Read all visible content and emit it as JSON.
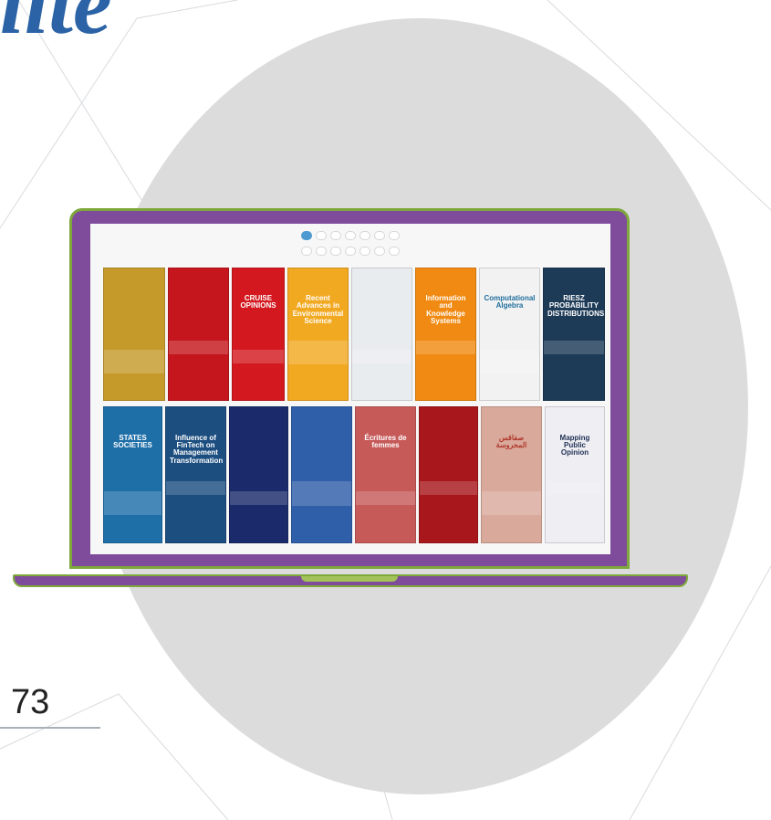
{
  "heading": "lite",
  "page_number": "73",
  "colors": {
    "heading_blue": "#2b63a6",
    "circle_grey": "#dcdcdc",
    "laptop_purple": "#7f4c9c",
    "laptop_trim_green": "#7ea83b"
  },
  "screen": {
    "nav_row1": [
      "",
      "",
      "",
      "",
      "",
      "",
      ""
    ],
    "nav_row2": [
      "",
      "",
      "",
      "",
      "",
      "",
      ""
    ],
    "books_row1": [
      {
        "title": "",
        "bg": "#c69a2a",
        "fg": "#ffffff"
      },
      {
        "title": "",
        "bg": "#c4161c",
        "fg": "#ffffff"
      },
      {
        "title": "CRUISE OPINIONS",
        "bg": "#d3191f",
        "fg": "#ffffff"
      },
      {
        "title": "Recent Advances in Environmental Science",
        "bg": "#f2a922",
        "fg": "#ffffff"
      },
      {
        "title": "",
        "bg": "#e9ecef",
        "fg": "#333333"
      },
      {
        "title": "Information and Knowledge Systems",
        "bg": "#f08a12",
        "fg": "#ffffff"
      },
      {
        "title": "Computational Algebra",
        "bg": "#f2f2f2",
        "fg": "#1f6e9e"
      },
      {
        "title": "RIESZ PROBABILITY DISTRIBUTIONS",
        "bg": "#1d3a57",
        "fg": "#ffffff"
      }
    ],
    "books_row2": [
      {
        "title": "STATES SOCIETIES",
        "bg": "#1e6ea8",
        "fg": "#ffffff"
      },
      {
        "title": "Influence of FinTech on Management Transformation",
        "bg": "#1c4e80",
        "fg": "#ffffff"
      },
      {
        "title": "",
        "bg": "#1a2a6b",
        "fg": "#ffffff"
      },
      {
        "title": "",
        "bg": "#2f5fa8",
        "fg": "#ffffff"
      },
      {
        "title": "Écritures de femmes",
        "bg": "#c65a59",
        "fg": "#ffffff"
      },
      {
        "title": "",
        "bg": "#a8171c",
        "fg": "#ffffff"
      },
      {
        "title": "صفاقس المحروسة",
        "bg": "#d9a99b",
        "fg": "#b03a2e"
      },
      {
        "title": "Mapping Public Opinion",
        "bg": "#eeeef3",
        "fg": "#223355"
      }
    ]
  }
}
